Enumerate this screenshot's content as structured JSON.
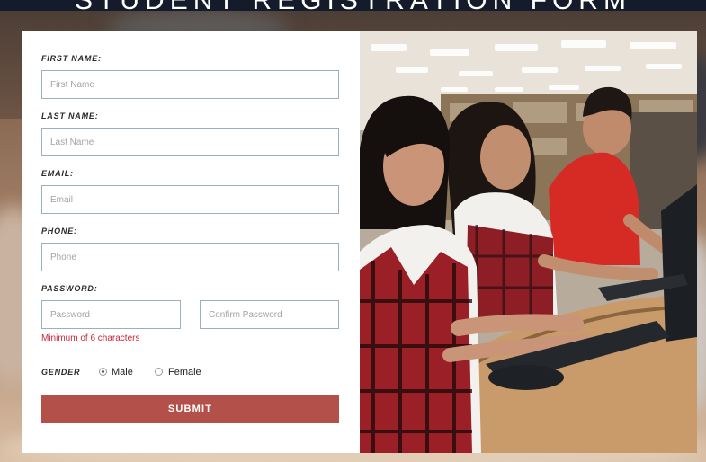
{
  "header": {
    "title": "STUDENT REGISTRATION FORM"
  },
  "form": {
    "first_name": {
      "label": "FIRST NAME:",
      "placeholder": "First Name",
      "value": ""
    },
    "last_name": {
      "label": "LAST NAME:",
      "placeholder": "Last Name",
      "value": ""
    },
    "email": {
      "label": "EMAIL:",
      "placeholder": "Email",
      "value": ""
    },
    "phone": {
      "label": "PHONE:",
      "placeholder": "Phone",
      "value": ""
    },
    "password": {
      "label": "PASSWORD:",
      "placeholder": "Password",
      "confirm_placeholder": "Confirm Password",
      "hint": "Minimum of 6 characters"
    },
    "gender": {
      "label": "GENDER",
      "options": [
        "Male",
        "Female"
      ],
      "selected": "Male"
    },
    "submit_label": "SUBMIT"
  },
  "colors": {
    "accent": "#b4504a",
    "error": "#c8283a",
    "input_border": "#9bb0bf"
  }
}
